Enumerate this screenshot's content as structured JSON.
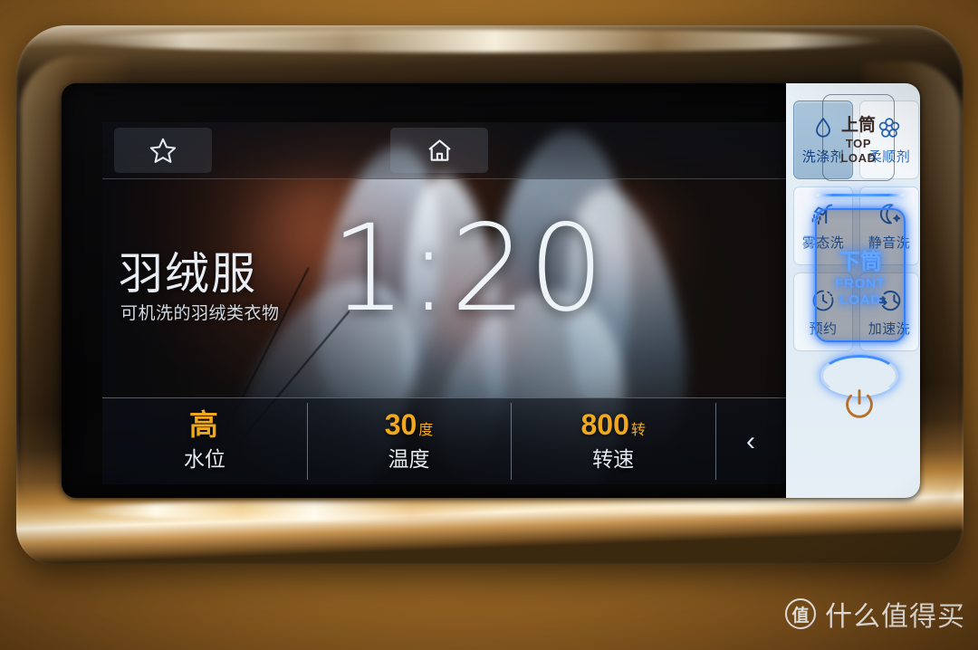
{
  "device": {
    "type": "washing-machine-control-panel"
  },
  "lcd": {
    "tabs": [
      {
        "id": "favorites",
        "icon": "star-icon"
      },
      {
        "id": "home",
        "icon": "home-icon"
      }
    ],
    "program": {
      "title": "羽绒服",
      "subtitle": "可机洗的羽绒类衣物",
      "remaining_time": "1:20"
    },
    "settings": [
      {
        "value": "高",
        "unit": "",
        "label": "水位"
      },
      {
        "value": "30",
        "unit": "度",
        "label": "温度"
      },
      {
        "value": "800",
        "unit": "转",
        "label": "转速"
      }
    ],
    "back_chevron": "‹"
  },
  "options": [
    {
      "label": "洗涤剂",
      "icon": "water-drop-icon",
      "active": true
    },
    {
      "label": "柔顺剂",
      "icon": "flower-icon",
      "active": false
    },
    {
      "label": "雾态洗",
      "icon": "shower-spray-icon",
      "active": false
    },
    {
      "label": "静音洗",
      "icon": "moon-icon",
      "active": false
    },
    {
      "label": "预约",
      "icon": "clock-dashed-icon",
      "active": false
    },
    {
      "label": "加速洗",
      "icon": "fast-clock-icon",
      "active": false
    }
  ],
  "hardkeys": {
    "top_load": {
      "cn": "上筒",
      "en_line1": "TOP",
      "en_line2": "LOAD",
      "state": "inactive"
    },
    "front_load": {
      "cn": "下筒",
      "en_line1": "FRONT",
      "en_line2": "LOAD",
      "state": "active"
    },
    "power": {
      "icon": "power-icon"
    }
  },
  "watermark": {
    "logo_char": "值",
    "text": "什么值得买"
  },
  "colors": {
    "accent_amber": "#f0a81e",
    "accent_blue": "#2f7fff",
    "option_blue": "#2a66b5",
    "panel_white": "#e6eff6"
  }
}
